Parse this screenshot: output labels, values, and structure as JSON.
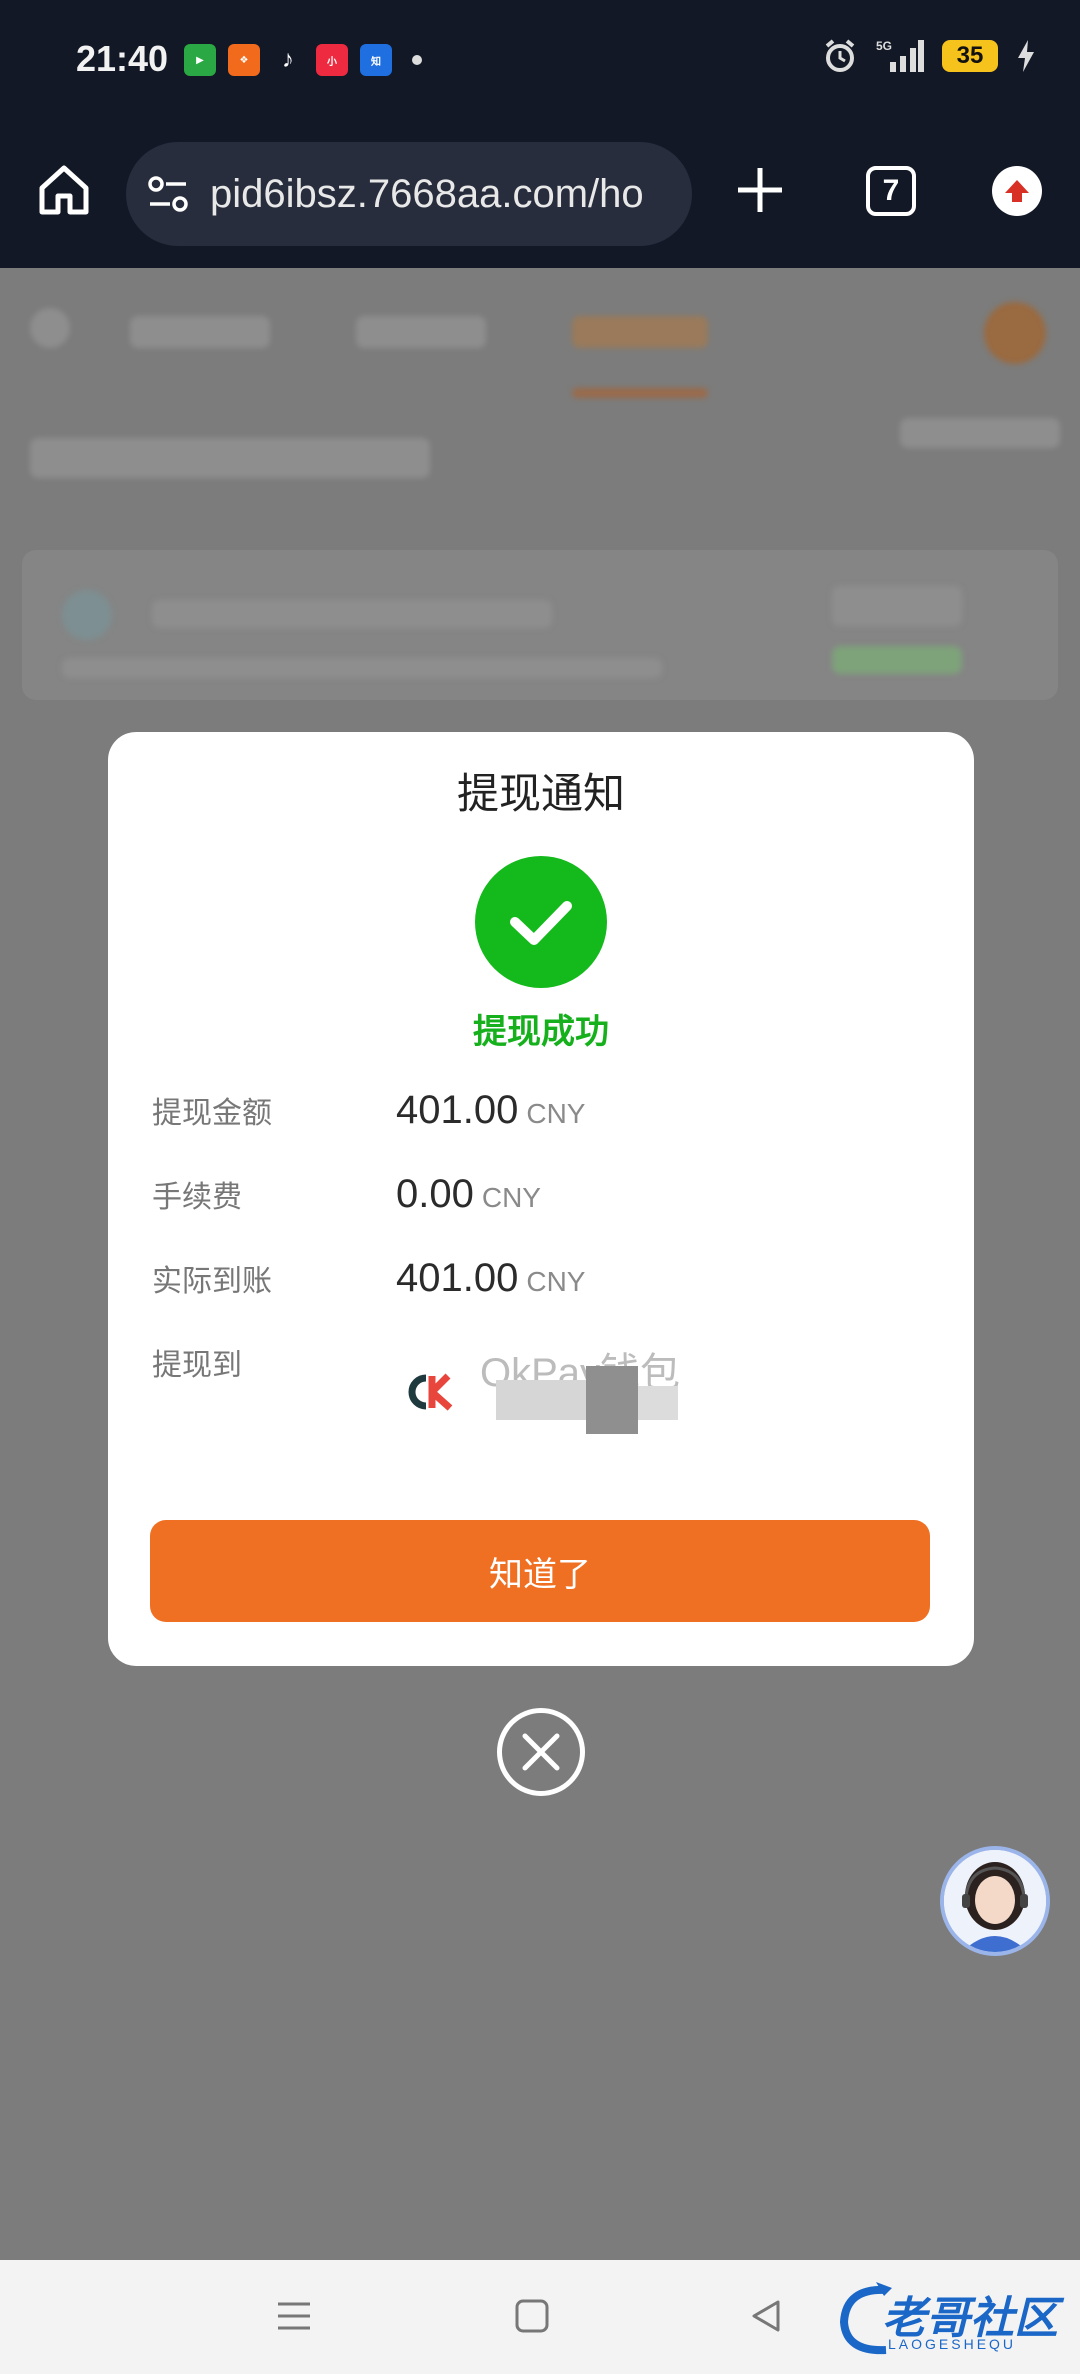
{
  "status_bar": {
    "time": "21:40",
    "battery": "35",
    "network": "5G"
  },
  "browser": {
    "url": "pid6ibsz.7668aa.com/ho",
    "tab_count": "7"
  },
  "modal": {
    "title": "提现通知",
    "status_text": "提现成功",
    "rows": [
      {
        "label": "提现金额",
        "value": "401.00",
        "unit": "CNY"
      },
      {
        "label": "手续费",
        "value": "0.00",
        "unit": "CNY"
      },
      {
        "label": "实际到账",
        "value": "401.00",
        "unit": "CNY"
      }
    ],
    "destination_label": "提现到",
    "wallet_name": "OkPay钱包",
    "button_label": "知道了"
  },
  "colors": {
    "success": "#14b91c",
    "primary_button": "#f07023",
    "status_bar_bg": "#121826"
  },
  "watermark": {
    "text": "老哥社区",
    "sub": "LAOGESHEQU"
  }
}
